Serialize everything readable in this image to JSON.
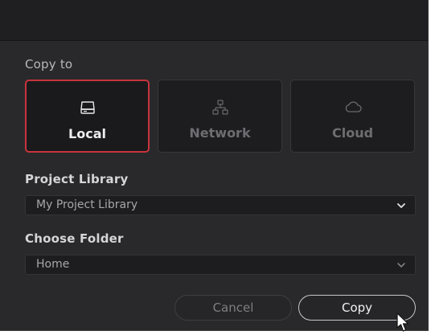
{
  "dialog": {
    "copy_to_label": "Copy to",
    "destinations": [
      {
        "label": "Local",
        "icon": "drive-icon",
        "selected": true
      },
      {
        "label": "Network",
        "icon": "network-icon",
        "selected": false
      },
      {
        "label": "Cloud",
        "icon": "cloud-icon",
        "selected": false
      }
    ],
    "project_library": {
      "label": "Project Library",
      "value": "My Project Library"
    },
    "choose_folder": {
      "label": "Choose Folder",
      "value": "Home"
    },
    "buttons": {
      "cancel": "Cancel",
      "copy": "Copy"
    }
  },
  "colors": {
    "accent_selected_border": "#c8343d",
    "background": "#29292b",
    "panel": "#1d1d1f"
  }
}
